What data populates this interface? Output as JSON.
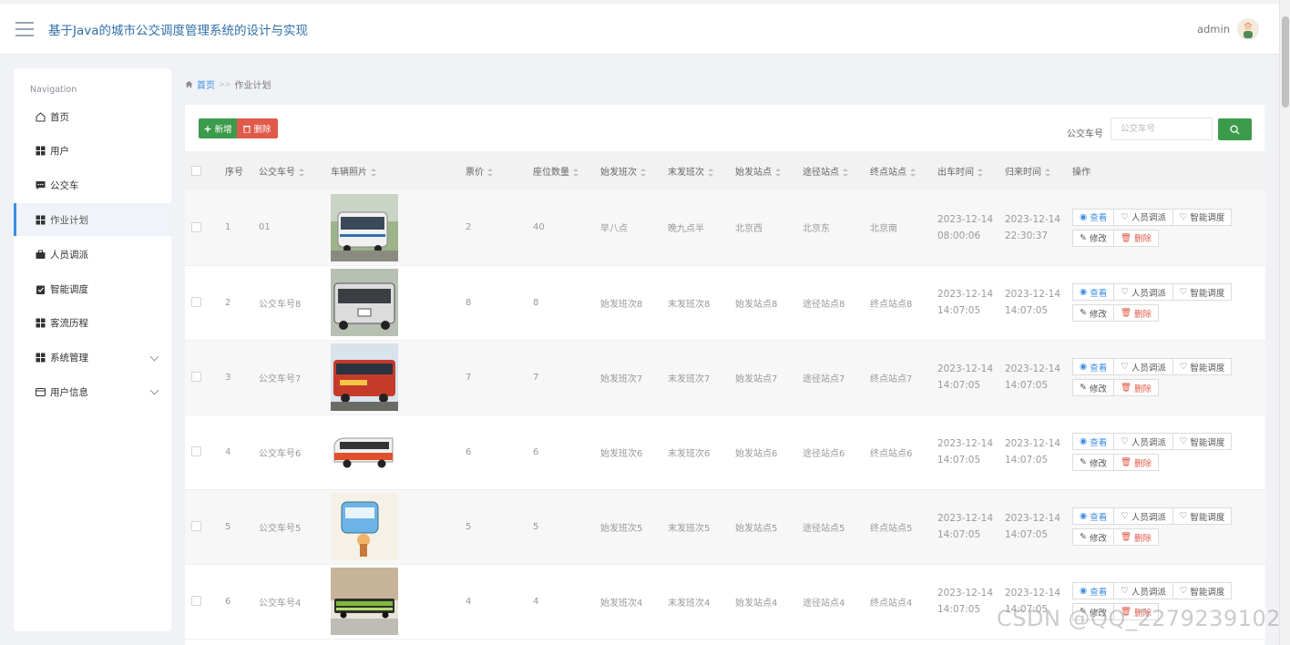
{
  "header": {
    "title": "基于Java的城市公交调度管理系统的设计与实现",
    "user": "admin"
  },
  "sidebar": {
    "heading": "Navigation",
    "items": [
      {
        "label": "首页",
        "icon": "home-icon"
      },
      {
        "label": "用户",
        "icon": "grid-icon"
      },
      {
        "label": "公交车",
        "icon": "comment-icon"
      },
      {
        "label": "作业计划",
        "icon": "grid-icon",
        "active": true
      },
      {
        "label": "人员调派",
        "icon": "briefcase-icon"
      },
      {
        "label": "智能调度",
        "icon": "clipboard-icon"
      },
      {
        "label": "客流历程",
        "icon": "grid-icon"
      },
      {
        "label": "系统管理",
        "icon": "grid-icon",
        "expandable": true
      },
      {
        "label": "用户信息",
        "icon": "card-icon",
        "expandable": true
      }
    ]
  },
  "breadcrumb": {
    "home": "首页",
    "separator": ">>",
    "current": "作业计划"
  },
  "toolbar": {
    "add_label": "新增",
    "delete_label": "删除",
    "search_label": "公交车号",
    "search_placeholder": "公交车号"
  },
  "table": {
    "headers": [
      "序号",
      "公交车号",
      "车辆照片",
      "票价",
      "座位数量",
      "始发班次",
      "末发班次",
      "始发站点",
      "途径站点",
      "终点站点",
      "出车时间",
      "归来时间",
      "操作"
    ],
    "rows": [
      {
        "index": "1",
        "bus_no": "01",
        "photo": "white-bus",
        "fare": "2",
        "seats": "40",
        "first": "早八点",
        "last": "晚九点半",
        "start": "北京西",
        "via": "北京东",
        "end": "北京南",
        "depart_date": "2023-12-14",
        "depart_time": "08:00:06",
        "return_date": "2023-12-14",
        "return_time": "22:30:37"
      },
      {
        "index": "2",
        "bus_no": "公交车号8",
        "photo": "grey-bus",
        "fare": "8",
        "seats": "8",
        "first": "始发班次8",
        "last": "末发班次8",
        "start": "始发站点8",
        "via": "途径站点8",
        "end": "终点站点8",
        "depart_date": "2023-12-14",
        "depart_time": "14:07:05",
        "return_date": "2023-12-14",
        "return_time": "14:07:05"
      },
      {
        "index": "3",
        "bus_no": "公交车号7",
        "photo": "red-bus",
        "fare": "7",
        "seats": "7",
        "first": "始发班次7",
        "last": "末发班次7",
        "start": "始发站点7",
        "via": "途径站点7",
        "end": "终点站点7",
        "depart_date": "2023-12-14",
        "depart_time": "14:07:05",
        "return_date": "2023-12-14",
        "return_time": "14:07:05"
      },
      {
        "index": "4",
        "bus_no": "公交车号6",
        "photo": "orange-coach",
        "fare": "6",
        "seats": "6",
        "first": "始发班次6",
        "last": "末发班次6",
        "start": "始发站点6",
        "via": "途径站点6",
        "end": "终点站点6",
        "depart_date": "2023-12-14",
        "depart_time": "14:07:05",
        "return_date": "2023-12-14",
        "return_time": "14:07:05"
      },
      {
        "index": "5",
        "bus_no": "公交车号5",
        "photo": "cartoon-bus",
        "fare": "5",
        "seats": "5",
        "first": "始发班次5",
        "last": "末发班次5",
        "start": "始发站点5",
        "via": "途径站点5",
        "end": "终点站点5",
        "depart_date": "2023-12-14",
        "depart_time": "14:07:05",
        "return_date": "2023-12-14",
        "return_time": "14:07:05"
      },
      {
        "index": "6",
        "bus_no": "公交车号4",
        "photo": "green-bus",
        "fare": "4",
        "seats": "4",
        "first": "始发班次4",
        "last": "末发班次4",
        "start": "始发站点4",
        "via": "途径站点4",
        "end": "终点站点4",
        "depart_date": "2023-12-14",
        "depart_time": "14:07:05",
        "return_date": "2023-12-14",
        "return_time": "14:07:05"
      }
    ],
    "actions": {
      "view": "查看",
      "dispatch": "人员调派",
      "schedule": "智能调度",
      "edit": "修改",
      "delete": "删除"
    }
  },
  "watermark": "CSDN @QQ_2279239102",
  "colors": {
    "primary": "#3d8ee0",
    "success": "#3c9b4b",
    "danger": "#e05a4a",
    "title": "#2f6fa8"
  }
}
